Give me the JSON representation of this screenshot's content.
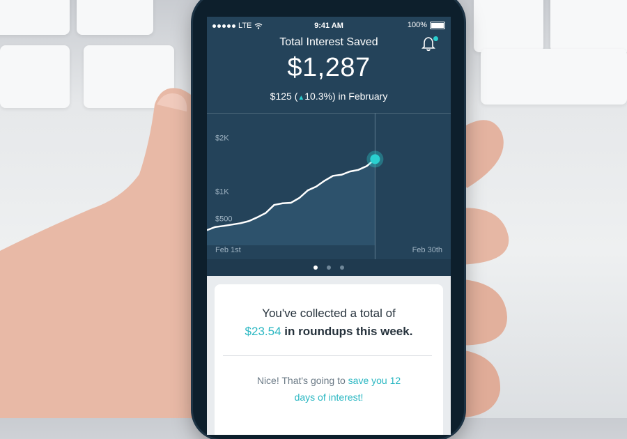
{
  "status": {
    "carrier": "LTE",
    "time": "9:41 AM",
    "battery": "100%"
  },
  "header": {
    "title": "Total Interest Saved",
    "amount": "$1,287",
    "change_amount": "$125 (",
    "change_percent": "10.3%",
    "change_suffix": ") in February"
  },
  "colors": {
    "accent": "#2ad0d0",
    "background": "#24435a",
    "text_primary": "#26323c"
  },
  "icons": [
    "bell-icon",
    "wifi-icon",
    "battery-icon",
    "up-arrow-icon"
  ],
  "chart_data": {
    "type": "area",
    "x_start_label": "Feb 1st",
    "x_end_label": "Feb 30th",
    "y_ticks": [
      "$2K",
      "$1K",
      "$500"
    ],
    "y_tick_values": [
      2000,
      1000,
      500
    ],
    "x": [
      1,
      2,
      3,
      5,
      6,
      7,
      8,
      9,
      10,
      11,
      12,
      13,
      14,
      15,
      16,
      17,
      18,
      19,
      20,
      21
    ],
    "values": [
      280,
      340,
      360,
      410,
      450,
      520,
      600,
      750,
      780,
      790,
      880,
      1020,
      1090,
      1200,
      1290,
      1310,
      1370,
      1400,
      1470,
      1600
    ],
    "highlight": {
      "x": 21,
      "value": 1600
    },
    "ylim": [
      0,
      2200
    ],
    "xlim": [
      1,
      30
    ]
  },
  "pager": {
    "count": 3,
    "active": 0
  },
  "card": {
    "line1": "You've collected a total of",
    "amount": "$23.54",
    "line2_suffix": " in roundups this week.",
    "line3": "Nice! That's going to ",
    "line3_highlight": "save you 12",
    "line4_highlight": "days of interest!"
  }
}
